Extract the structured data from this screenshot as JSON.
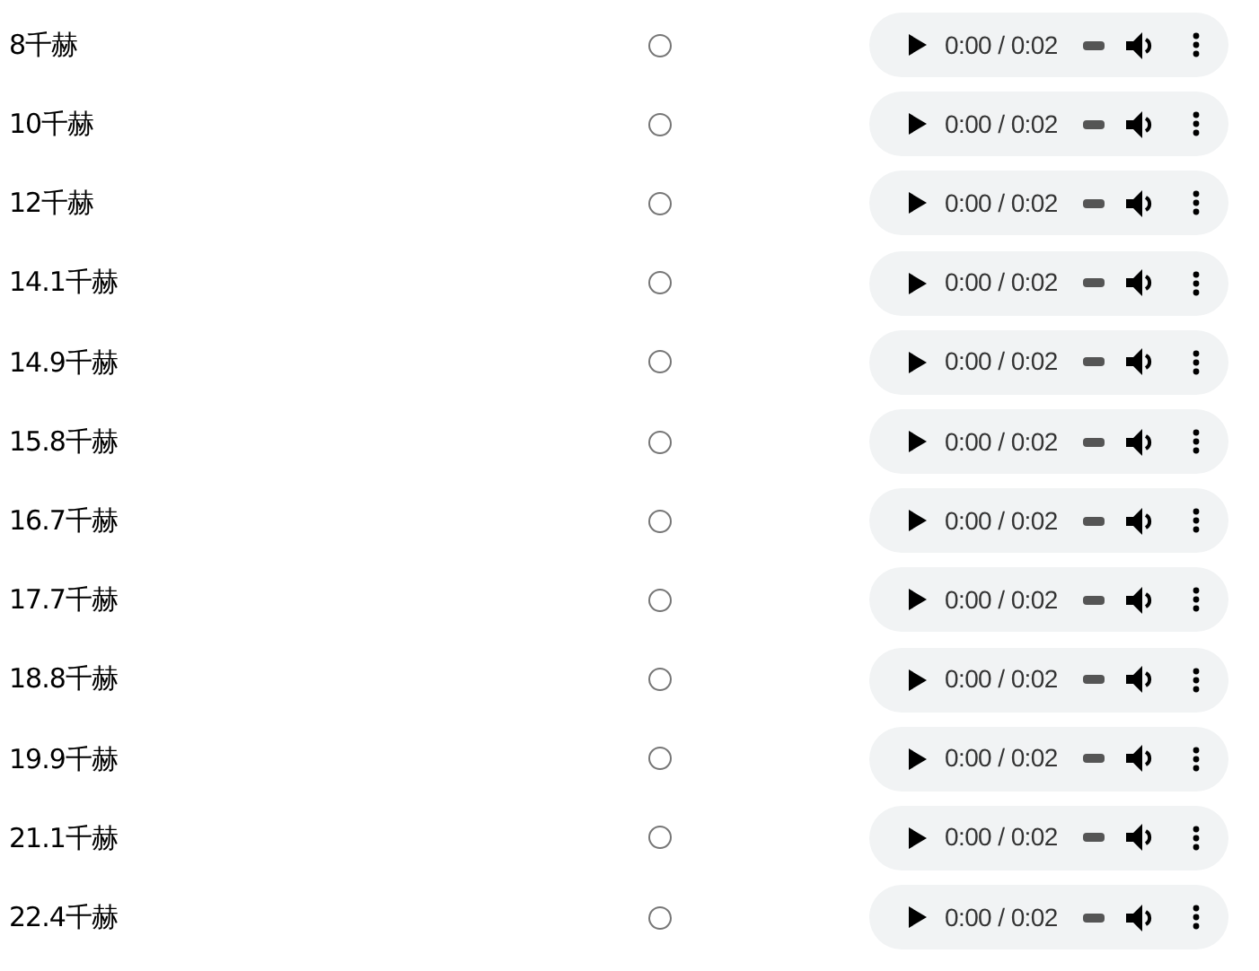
{
  "rows": [
    {
      "label": "8千赫",
      "selected": false,
      "time": "0:00 / 0:02"
    },
    {
      "label": "10千赫",
      "selected": false,
      "time": "0:00 / 0:02"
    },
    {
      "label": "12千赫",
      "selected": false,
      "time": "0:00 / 0:02"
    },
    {
      "label": "14.1千赫",
      "selected": false,
      "time": "0:00 / 0:02"
    },
    {
      "label": "14.9千赫",
      "selected": false,
      "time": "0:00 / 0:02"
    },
    {
      "label": "15.8千赫",
      "selected": false,
      "time": "0:00 / 0:02"
    },
    {
      "label": "16.7千赫",
      "selected": false,
      "time": "0:00 / 0:02"
    },
    {
      "label": "17.7千赫",
      "selected": false,
      "time": "0:00 / 0:02"
    },
    {
      "label": "18.8千赫",
      "selected": false,
      "time": "0:00 / 0:02"
    },
    {
      "label": "19.9千赫",
      "selected": false,
      "time": "0:00 / 0:02"
    },
    {
      "label": "21.1千赫",
      "selected": false,
      "time": "0:00 / 0:02"
    },
    {
      "label": "22.4千赫",
      "selected": false,
      "time": "0:00 / 0:02"
    }
  ]
}
